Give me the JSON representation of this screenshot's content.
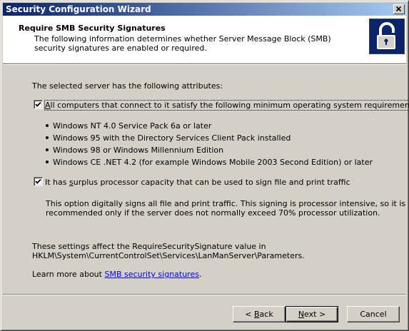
{
  "window": {
    "title": "Security Configuration Wizard"
  },
  "header": {
    "title": "Require SMB Security Signatures",
    "description": "The following information determines whether Server Message Block (SMB) security signatures are enabled or required."
  },
  "intro": "The selected server has the following attributes:",
  "checkbox1": {
    "checked": true,
    "label_prefix": "",
    "label_mnemonic": "A",
    "label_rest": "ll computers that connect to it satisfy the following minimum operating system requirements:"
  },
  "requirements": [
    "Windows NT 4.0 Service Pack 6a or later",
    "Windows 95 with the Directory Services Client Pack installed",
    "Windows 98 or Windows Millennium Edition",
    "Windows CE .NET 4.2 (for example Windows Mobile 2003 Second Edition) or later"
  ],
  "checkbox2": {
    "checked": true,
    "label_prefix": "It has ",
    "label_mnemonic": "s",
    "label_rest": "urplus processor capacity that can be used to sign file and print traffic"
  },
  "option_note": {
    "line1": "This option digitally signs all file and print traffic. This signing is processor intensive, so it is",
    "line2": "recommended only if the server does not normally exceed 70% processor utilization."
  },
  "settings_note": {
    "line1": "These settings affect the RequireSecuritySignature value in",
    "line2": "HKLM\\System\\CurrentControlSet\\Services\\LanManServer\\Parameters."
  },
  "learn_more": {
    "prefix": "Learn more about ",
    "link": "SMB security signatures",
    "suffix": "."
  },
  "buttons": {
    "back_prefix": "< ",
    "back_mnemonic": "B",
    "back_rest": "ack",
    "next_mnemonic": "N",
    "next_rest": "ext >",
    "cancel": "Cancel"
  },
  "icons": {
    "close": "close-icon",
    "lock": "padlock-icon",
    "check": "checkmark-icon"
  },
  "colors": {
    "titlebar_start": "#0a246a",
    "titlebar_end": "#a6caf0",
    "link": "#0000ff",
    "face": "#d4d0c8"
  }
}
